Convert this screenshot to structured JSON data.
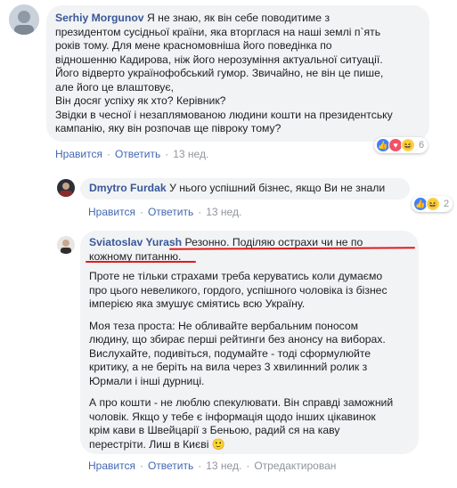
{
  "comments": [
    {
      "author": "Serhiy Morgunov",
      "lines": [
        "Я не знаю, як він себе поводитиме з",
        "президентом сусідньої країни, яка вторглася на наші землі п`ять",
        "років тому. Для мене красномовніша його поведінка по",
        "відношенню Кадирова, ніж його нерозуміння актуальної ситуації.",
        "Його відверто українофобський гумор. Звичайно, не він це пише,",
        "але його це влаштовує,",
        "Він досяг успіху як хто? Керівник?",
        "Звідки в чесної і незаплямованою людини кошти на президентську",
        "кампанію, яку він розпочав ще півроку тому?"
      ],
      "like_label": "Нравится",
      "reply_label": "Ответить",
      "time": "13 нед.",
      "reaction_count": "6"
    },
    {
      "author": "Dmytro Furdak",
      "text": "У нього успішний бізнес, якщо Ви не знали",
      "like_label": "Нравится",
      "reply_label": "Ответить",
      "time": "13 нед.",
      "reaction_count": "2"
    },
    {
      "author": "Sviatoslav Yurash",
      "first_line": "Резонно. Поділяю острахи чи не по",
      "second_line": "кожному питанню.",
      "paragraphs": [
        [
          "Проте не тільки страхами треба керуватись коли думаємо",
          "про цього невеликого, гордого, успішного чоловіка із бізнес",
          "імперією яка змушує сміятись всю Україну."
        ],
        [
          "Моя теза проста: Не обливайте вербальним поносом",
          "людину, що збирає перші рейтинги без анонсу на виборах.",
          "Вислухайте, подивіться, подумайте - тоді сформулюйте",
          "критику, а не беріть на вила через 3 хвилинний ролик з",
          "Юрмали і інші дурниці."
        ],
        [
          "А про кошти - не люблю спекулювати. Він справді заможний",
          "чоловік. Якщо у тебе є інформація щодо інших цікавинок",
          "крім кави в Швейцарії з Беньою, радий ся на каву",
          "перестріти. Лиш в Києві"
        ]
      ],
      "emoji": "🙂",
      "like_label": "Нравится",
      "reply_label": "Ответить",
      "time": "13 нед.",
      "edited_label": "Отредактирован"
    }
  ],
  "colors": {
    "name": "#385898",
    "link": "#4267b2",
    "meta": "#90949c",
    "bubble": "#f2f3f5",
    "underline": "#e01b1b"
  },
  "icons": {
    "like": "like-icon",
    "love": "love-icon",
    "haha": "haha-icon"
  }
}
